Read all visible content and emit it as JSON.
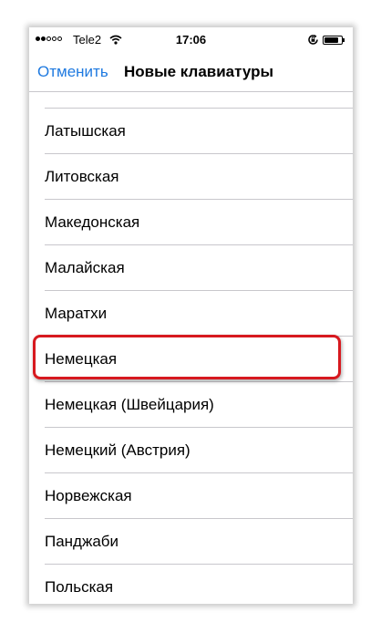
{
  "status_bar": {
    "carrier": "Tele2",
    "time": "17:06",
    "signal_bars_filled": 2,
    "signal_bars_total": 5,
    "battery_level": 0.85,
    "icons": [
      "wifi-icon",
      "orientation-lock-icon",
      "battery-icon"
    ]
  },
  "nav": {
    "cancel_label": "Отменить",
    "title": "Новые клавиатуры"
  },
  "keyboards": [
    "Латышская",
    "Литовская",
    "Македонская",
    "Малайская",
    "Маратхи",
    "Немецкая",
    "Немецкая (Швейцария)",
    "Немецкий (Австрия)",
    "Норвежская",
    "Панджаби",
    "Польская"
  ],
  "highlighted_item": "Немецкая",
  "colors": {
    "accent": "#1f7ae0",
    "highlight": "#d7191f",
    "separator": "#c8c7cc"
  }
}
